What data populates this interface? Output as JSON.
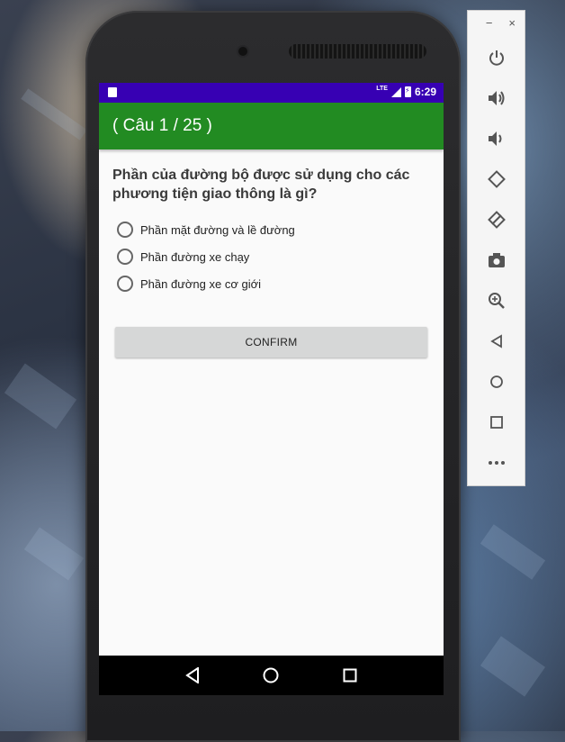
{
  "status_bar": {
    "network_label": "LTE",
    "time": "6:29"
  },
  "app_bar": {
    "title": "( Câu 1 / 25 )"
  },
  "question": {
    "text": "Phần của đường bộ được sử dụng cho các phương tiện giao thông là gì?",
    "options": [
      "Phần mặt đường và lề đường",
      "Phần đường xe chạy",
      "Phần đường xe cơ giới"
    ],
    "selected_index": null
  },
  "confirm_label": "CONFIRM",
  "colors": {
    "status_bar": "#3700b3",
    "app_bar": "#228b22",
    "screen_bg": "#fafafa",
    "button_bg": "#d6d7d7"
  },
  "navigation": {
    "buttons": [
      "back-icon",
      "home-icon",
      "recents-icon"
    ]
  },
  "emulator_toolbar": {
    "window_controls": [
      "−",
      "×"
    ],
    "tools": [
      "power-icon",
      "volume-up-icon",
      "volume-down-icon",
      "rotate-left-icon",
      "rotate-right-icon",
      "camera-icon",
      "zoom-icon",
      "back-icon",
      "home-icon",
      "overview-icon",
      "more-icon"
    ]
  }
}
